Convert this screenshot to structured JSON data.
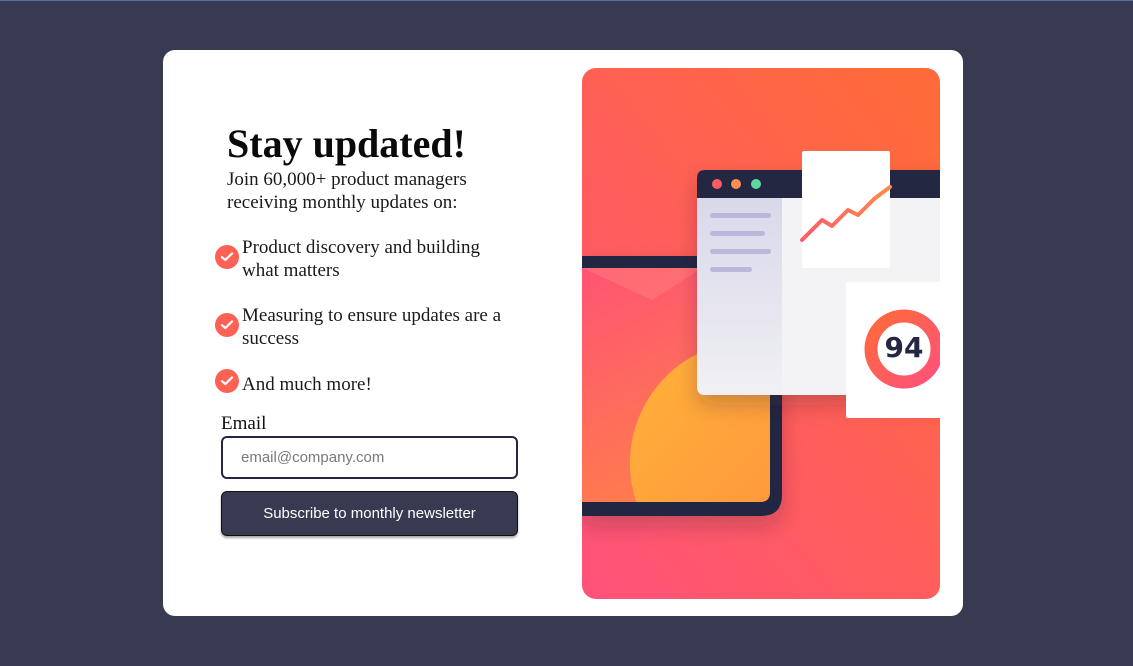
{
  "card": {
    "title": "Stay updated!",
    "subtitle": "Join 60,000+ product managers receiving monthly updates on:",
    "features": [
      "Product discovery and building what matters",
      "Measuring to ensure updates are a success",
      "And much more!"
    ],
    "form": {
      "email_label": "Email",
      "email_placeholder": "email@company.com",
      "email_value": "",
      "submit_label": "Subscribe to monthly newsletter"
    },
    "illustration": {
      "score": "94"
    }
  },
  "colors": {
    "page_background": "#373a50",
    "card_background": "#ffffff",
    "accent": "#ff6155",
    "button": "#373a50",
    "dark_navy": "#242742"
  },
  "icons": {
    "feature_check": "check-circle-icon"
  }
}
